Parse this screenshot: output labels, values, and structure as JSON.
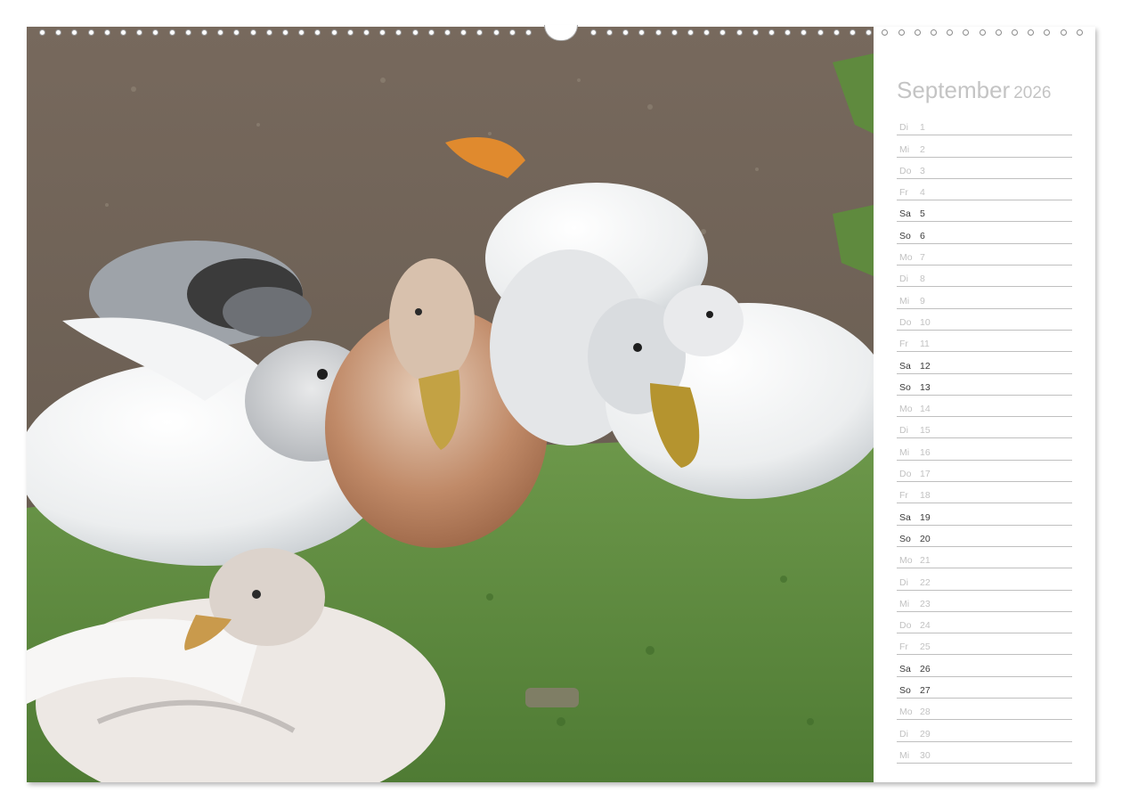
{
  "calendar": {
    "month": "September",
    "year": "2026",
    "days": [
      {
        "name": "Di",
        "num": "1",
        "weekend": false
      },
      {
        "name": "Mi",
        "num": "2",
        "weekend": false
      },
      {
        "name": "Do",
        "num": "3",
        "weekend": false
      },
      {
        "name": "Fr",
        "num": "4",
        "weekend": false
      },
      {
        "name": "Sa",
        "num": "5",
        "weekend": true
      },
      {
        "name": "So",
        "num": "6",
        "weekend": true
      },
      {
        "name": "Mo",
        "num": "7",
        "weekend": false
      },
      {
        "name": "Di",
        "num": "8",
        "weekend": false
      },
      {
        "name": "Mi",
        "num": "9",
        "weekend": false
      },
      {
        "name": "Do",
        "num": "10",
        "weekend": false
      },
      {
        "name": "Fr",
        "num": "11",
        "weekend": false
      },
      {
        "name": "Sa",
        "num": "12",
        "weekend": true
      },
      {
        "name": "So",
        "num": "13",
        "weekend": true
      },
      {
        "name": "Mo",
        "num": "14",
        "weekend": false
      },
      {
        "name": "Di",
        "num": "15",
        "weekend": false
      },
      {
        "name": "Mi",
        "num": "16",
        "weekend": false
      },
      {
        "name": "Do",
        "num": "17",
        "weekend": false
      },
      {
        "name": "Fr",
        "num": "18",
        "weekend": false
      },
      {
        "name": "Sa",
        "num": "19",
        "weekend": true
      },
      {
        "name": "So",
        "num": "20",
        "weekend": true
      },
      {
        "name": "Mo",
        "num": "21",
        "weekend": false
      },
      {
        "name": "Di",
        "num": "22",
        "weekend": false
      },
      {
        "name": "Mi",
        "num": "23",
        "weekend": false
      },
      {
        "name": "Do",
        "num": "24",
        "weekend": false
      },
      {
        "name": "Fr",
        "num": "25",
        "weekend": false
      },
      {
        "name": "Sa",
        "num": "26",
        "weekend": true
      },
      {
        "name": "So",
        "num": "27",
        "weekend": true
      },
      {
        "name": "Mo",
        "num": "28",
        "weekend": false
      },
      {
        "name": "Di",
        "num": "29",
        "weekend": false
      },
      {
        "name": "Mi",
        "num": "30",
        "weekend": false
      }
    ]
  },
  "colors": {
    "weekday_text": "#c2c2c2",
    "weekend_text": "#3a3a3a",
    "header_text": "#c4c4c4",
    "rule_line": "#bfbfbf"
  }
}
